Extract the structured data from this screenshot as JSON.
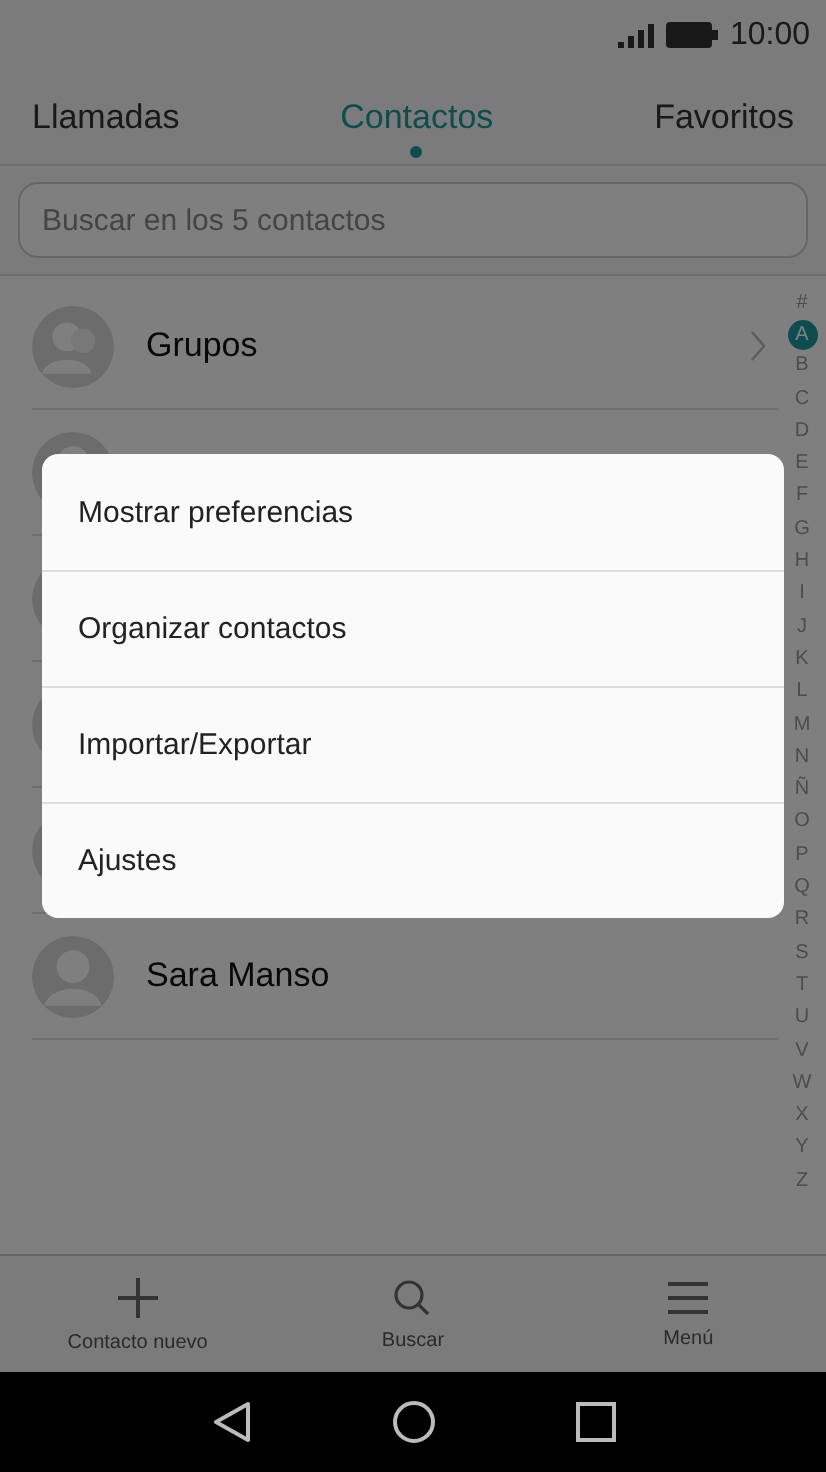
{
  "status_bar": {
    "time": "10:00"
  },
  "tabs": [
    {
      "label": "Llamadas",
      "selected": false
    },
    {
      "label": "Contactos",
      "selected": true
    },
    {
      "label": "Favoritos",
      "selected": false
    }
  ],
  "search": {
    "placeholder": "Buscar en los 5 contactos"
  },
  "contacts": [
    {
      "kind": "group",
      "name": "Grupos"
    },
    {
      "kind": "contact"
    },
    {
      "kind": "contact"
    },
    {
      "kind": "contact"
    },
    {
      "kind": "contact"
    },
    {
      "kind": "contact",
      "name": "Sara Manso"
    }
  ],
  "index": [
    {
      "letter": "#",
      "selected": false
    },
    {
      "letter": "A",
      "selected": true
    },
    {
      "letter": "B",
      "selected": false
    },
    {
      "letter": "C",
      "selected": false
    },
    {
      "letter": "D",
      "selected": false
    },
    {
      "letter": "E",
      "selected": false
    },
    {
      "letter": "F",
      "selected": false
    },
    {
      "letter": "G",
      "selected": false
    },
    {
      "letter": "H",
      "selected": false
    },
    {
      "letter": "I",
      "selected": false
    },
    {
      "letter": "J",
      "selected": false
    },
    {
      "letter": "K",
      "selected": false
    },
    {
      "letter": "L",
      "selected": false
    },
    {
      "letter": "M",
      "selected": false
    },
    {
      "letter": "N",
      "selected": false
    },
    {
      "letter": "Ñ",
      "selected": false
    },
    {
      "letter": "O",
      "selected": false
    },
    {
      "letter": "P",
      "selected": false
    },
    {
      "letter": "Q",
      "selected": false
    },
    {
      "letter": "R",
      "selected": false
    },
    {
      "letter": "S",
      "selected": false
    },
    {
      "letter": "T",
      "selected": false
    },
    {
      "letter": "U",
      "selected": false
    },
    {
      "letter": "V",
      "selected": false
    },
    {
      "letter": "W",
      "selected": false
    },
    {
      "letter": "X",
      "selected": false
    },
    {
      "letter": "Y",
      "selected": false
    },
    {
      "letter": "Z",
      "selected": false
    }
  ],
  "toolbar": [
    {
      "kind": "add",
      "label": "Contacto nuevo"
    },
    {
      "kind": "search",
      "label": "Buscar"
    },
    {
      "kind": "menu",
      "label": "Menú"
    }
  ],
  "menu": [
    {
      "label": "Mostrar preferencias"
    },
    {
      "label": "Organizar contactos"
    },
    {
      "label": "Importar/Exportar"
    },
    {
      "label": "Ajustes"
    }
  ]
}
